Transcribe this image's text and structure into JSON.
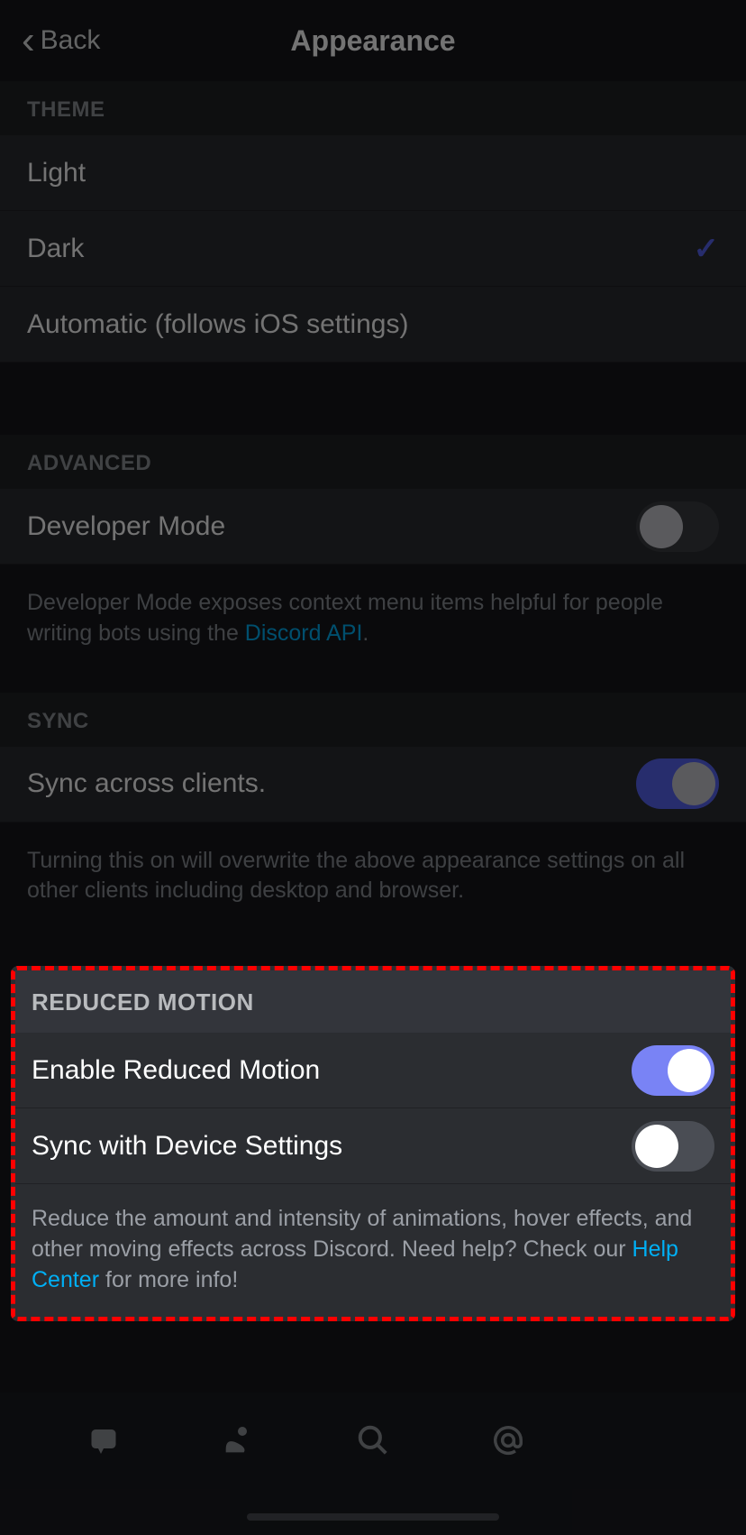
{
  "header": {
    "back_label": "Back",
    "title": "Appearance"
  },
  "sections": {
    "theme": {
      "header": "THEME",
      "items": [
        {
          "label": "Light",
          "selected": false
        },
        {
          "label": "Dark",
          "selected": true
        },
        {
          "label": "Automatic (follows iOS settings)",
          "selected": false
        }
      ]
    },
    "advanced": {
      "header": "ADVANCED",
      "dev_mode": {
        "label": "Developer Mode",
        "on": false
      },
      "desc_prefix": "Developer Mode exposes context menu items helpful for people writing bots using the ",
      "desc_link": "Discord API",
      "desc_suffix": "."
    },
    "sync": {
      "header": "SYNC",
      "sync_clients": {
        "label": "Sync across clients.",
        "on": true
      },
      "desc": "Turning this on will overwrite the above appearance settings on all other clients including desktop and browser."
    },
    "reduced_motion": {
      "header": "REDUCED MOTION",
      "enable": {
        "label": "Enable Reduced Motion",
        "on": true
      },
      "sync_device": {
        "label": "Sync with Device Settings",
        "on": false
      },
      "desc_prefix": "Reduce the amount and intensity of animations, hover effects, and other moving effects across Discord. Need help? Check our ",
      "desc_link": "Help Center",
      "desc_suffix": " for more info!"
    }
  }
}
